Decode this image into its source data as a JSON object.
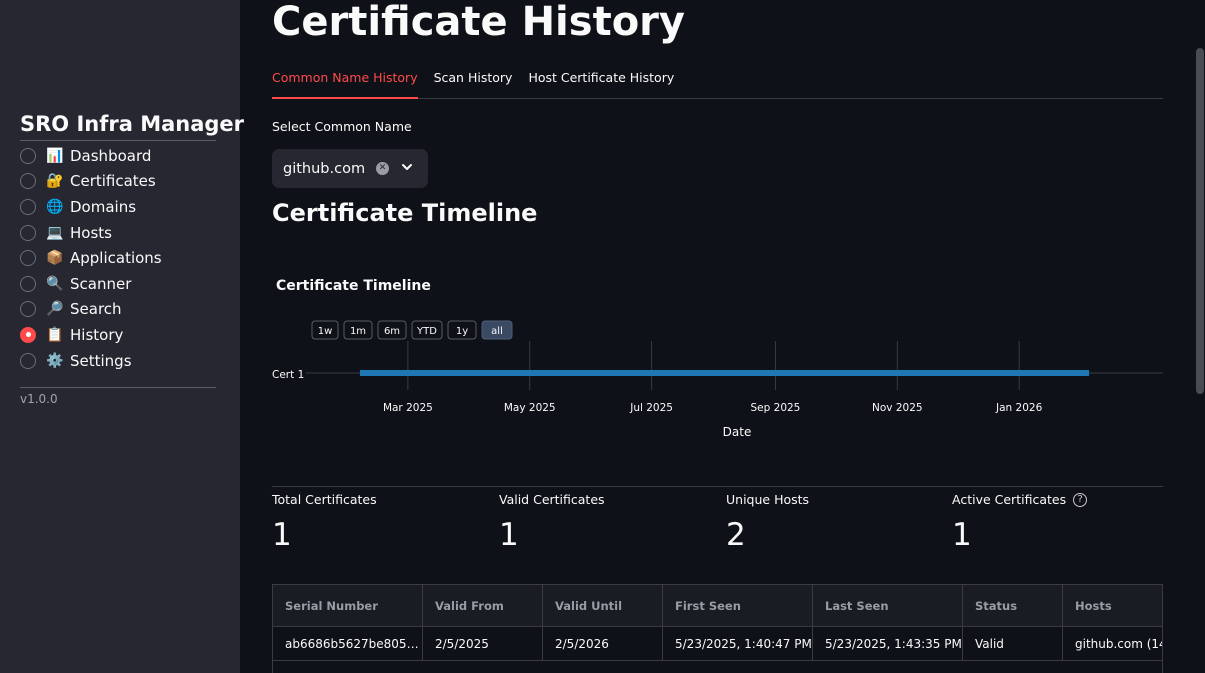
{
  "sidebar": {
    "title": "SRO Infra Manager",
    "items": [
      {
        "label": "Dashboard",
        "icon": "📊",
        "icon_name": "bar-chart-icon",
        "selected": false
      },
      {
        "label": "Certificates",
        "icon": "🔐",
        "icon_name": "lock-with-key-icon",
        "selected": false
      },
      {
        "label": "Domains",
        "icon": "🌐",
        "icon_name": "globe-icon",
        "selected": false
      },
      {
        "label": "Hosts",
        "icon": "💻",
        "icon_name": "laptop-icon",
        "selected": false
      },
      {
        "label": "Applications",
        "icon": "📦",
        "icon_name": "package-icon",
        "selected": false
      },
      {
        "label": "Scanner",
        "icon": "🔍",
        "icon_name": "magnifier-icon",
        "selected": false
      },
      {
        "label": "Search",
        "icon": "🔎",
        "icon_name": "search-icon",
        "selected": false
      },
      {
        "label": "History",
        "icon": "📋",
        "icon_name": "clipboard-icon",
        "selected": true
      },
      {
        "label": "Settings",
        "icon": "⚙️",
        "icon_name": "gear-icon",
        "selected": false
      }
    ],
    "version": "v1.0.0"
  },
  "page": {
    "title": "Certificate History",
    "tabs": [
      "Common Name History",
      "Scan History",
      "Host Certificate History"
    ],
    "active_tab": 0,
    "select_label": "Select Common Name",
    "select_value": "github.com",
    "section_title": "Certificate Timeline"
  },
  "chart_data": {
    "type": "timeline",
    "title": "Certificate Timeline",
    "xlabel": "Date",
    "ylabel": "",
    "range_buttons": [
      "1w",
      "1m",
      "6m",
      "YTD",
      "1y",
      "all"
    ],
    "active_range": "all",
    "x_ticks": [
      "Mar 2025",
      "May 2025",
      "Jul 2025",
      "Sep 2025",
      "Nov 2025",
      "Jan 2026"
    ],
    "x_tick_dates": [
      "2025-03-01",
      "2025-05-01",
      "2025-07-01",
      "2025-09-01",
      "2025-11-01",
      "2026-01-01"
    ],
    "xlim": [
      "2025-01-09",
      "2026-03-14"
    ],
    "grid": true,
    "series": [
      {
        "name": "Cert 1",
        "start": "2025-02-05",
        "end": "2026-02-05",
        "color": "#1f77b4"
      }
    ]
  },
  "metrics": [
    {
      "label": "Total Certificates",
      "value": "1",
      "help": false
    },
    {
      "label": "Valid Certificates",
      "value": "1",
      "help": false
    },
    {
      "label": "Unique Hosts",
      "value": "2",
      "help": false
    },
    {
      "label": "Active Certificates",
      "value": "1",
      "help": true
    }
  ],
  "table": {
    "columns": [
      "Serial Number",
      "Valid From",
      "Valid Until",
      "First Seen",
      "Last Seen",
      "Status",
      "Hosts"
    ],
    "rows": [
      [
        "ab6686b5627be805…",
        "2/5/2025",
        "2/5/2026",
        "5/23/2025, 1:40:47 PM",
        "5/23/2025, 1:43:35 PM",
        "Valid",
        "github.com (14"
      ]
    ]
  },
  "colors": {
    "background": "#0e1117",
    "sidebar": "#262730",
    "accent": "#ff4b4b",
    "bar": "#1f77b4"
  }
}
